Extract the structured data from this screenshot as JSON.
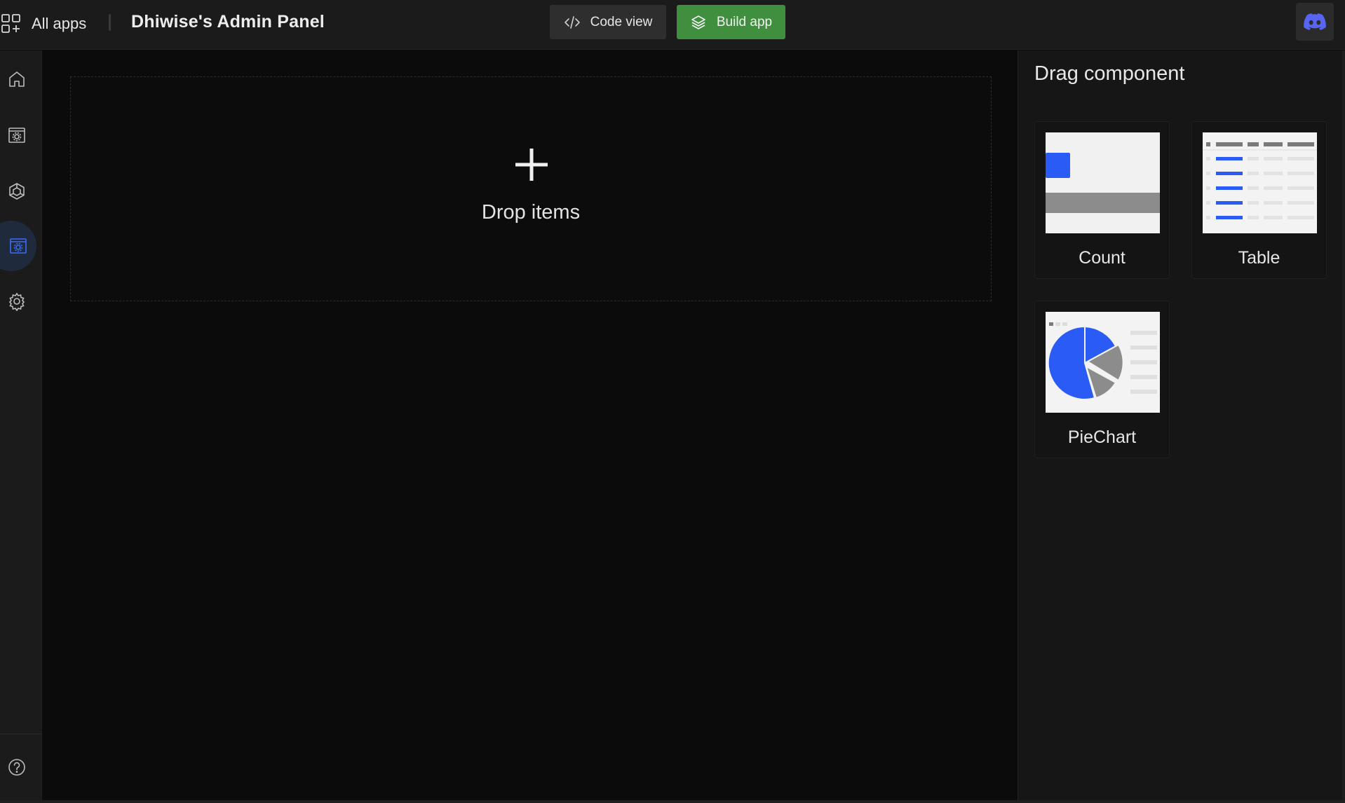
{
  "header": {
    "all_apps_label": "All apps",
    "app_title": "Dhiwise's Admin Panel",
    "code_view_label": "Code view",
    "build_app_label": "Build app"
  },
  "sidebar": {
    "items": [
      {
        "name": "home",
        "icon": "home-icon",
        "active": false
      },
      {
        "name": "app-settings",
        "icon": "window-gear-icon",
        "active": false
      },
      {
        "name": "models",
        "icon": "cube-icon",
        "active": false
      },
      {
        "name": "dashboard-builder",
        "icon": "window-gear-icon",
        "active": true
      },
      {
        "name": "settings",
        "icon": "gear-icon",
        "active": false
      }
    ],
    "help_icon": "help-icon"
  },
  "canvas": {
    "drop_label": "Drop items",
    "plus_icon": "plus-icon"
  },
  "panel": {
    "title": "Drag component",
    "components": [
      {
        "label": "Count",
        "thumb": "count-thumbnail"
      },
      {
        "label": "Table",
        "thumb": "table-thumbnail"
      },
      {
        "label": "PieChart",
        "thumb": "piechart-thumbnail"
      }
    ]
  },
  "colors": {
    "accent_blue": "#2a5cf5",
    "build_green": "#3f8f3e",
    "discord_purple": "#5865f2",
    "active_icon": "#3b6df0"
  }
}
